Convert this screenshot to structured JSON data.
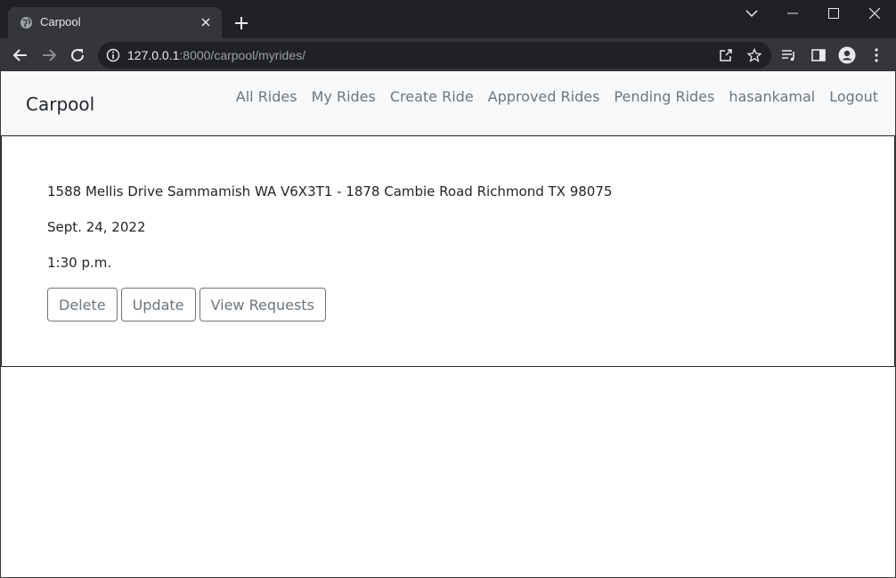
{
  "browser": {
    "tab_title": "Carpool",
    "url_host": "127.0.0.1",
    "url_rest": ":8000/carpool/myrides/"
  },
  "navbar": {
    "brand": "Carpool",
    "links": [
      "All Rides",
      "My Rides",
      "Create Ride",
      "Approved Rides",
      "Pending Rides",
      "hasankamal",
      "Logout"
    ]
  },
  "ride": {
    "route": "1588 Mellis Drive Sammamish WA V6X3T1 - 1878 Cambie Road Richmond TX 98075",
    "date": "Sept. 24, 2022",
    "time": "1:30 p.m.",
    "buttons": {
      "delete": "Delete",
      "update": "Update",
      "view_requests": "View Requests"
    }
  }
}
